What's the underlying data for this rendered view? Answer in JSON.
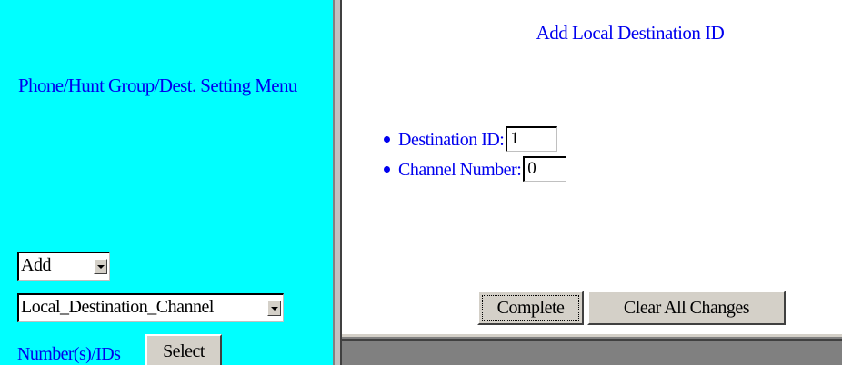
{
  "left_panel": {
    "menu_title": "Phone/Hunt Group/Dest. Setting Menu",
    "action_select": {
      "selected": "Add"
    },
    "type_select": {
      "selected": "Local_Destination_Channel"
    },
    "numbers_label": "Number(s)/IDs",
    "select_button": "Select"
  },
  "right_panel": {
    "title": "Add Local Destination ID",
    "fields": [
      {
        "label": "Destination ID:",
        "value": "1"
      },
      {
        "label": "Channel Number:",
        "value": "0"
      }
    ],
    "complete_button": "Complete",
    "clear_button": "Clear All Changes"
  },
  "colors": {
    "left_background": "#00ffff",
    "link_text": "#0000ee",
    "button_face": "#d4d0c8"
  }
}
